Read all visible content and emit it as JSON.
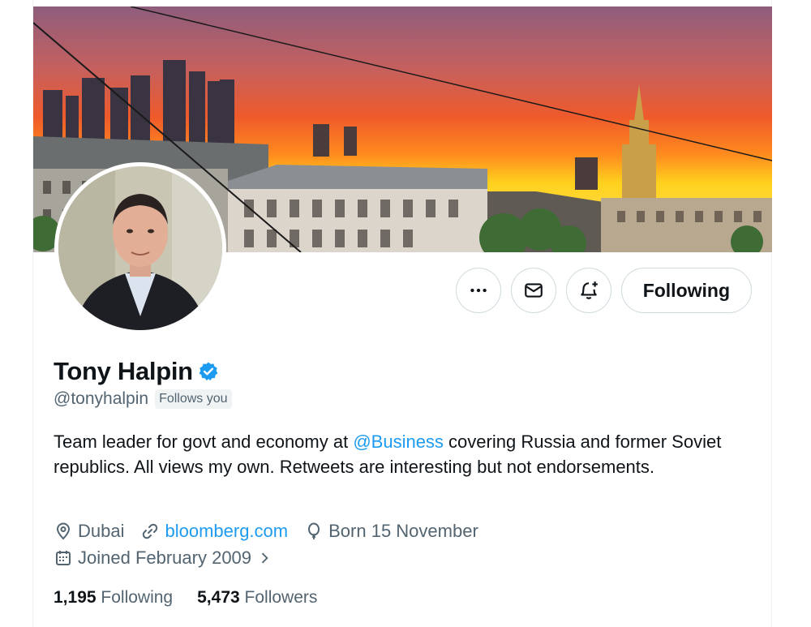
{
  "profile": {
    "name": "Tony Halpin",
    "handle": "@tonyhalpin",
    "follows_you": "Follows you",
    "bio_part1": "Team leader for govt and economy at ",
    "bio_mention": "@Business",
    "bio_part2": " covering Russia and former Soviet republics. All views my own. Retweets are interesting but not endorsements.",
    "location": "Dubai",
    "website": "bloomberg.com",
    "birthday": "Born 15 November",
    "joined": "Joined February 2009",
    "following_count": "1,195",
    "following_label": "Following",
    "followers_count": "5,473",
    "followers_label": "Followers"
  },
  "actions": {
    "following_button": "Following"
  },
  "icons": {
    "more": "more-icon",
    "message": "envelope-icon",
    "notify": "bell-plus-icon",
    "verified": "verified-badge-icon",
    "location": "location-pin-icon",
    "link": "link-icon",
    "birthday": "balloon-icon",
    "calendar": "calendar-icon",
    "chevron": "chevron-right-icon"
  },
  "colors": {
    "accent": "#1d9bf0",
    "text_primary": "#0f1419",
    "text_secondary": "#536471",
    "border": "#cfd9de"
  }
}
